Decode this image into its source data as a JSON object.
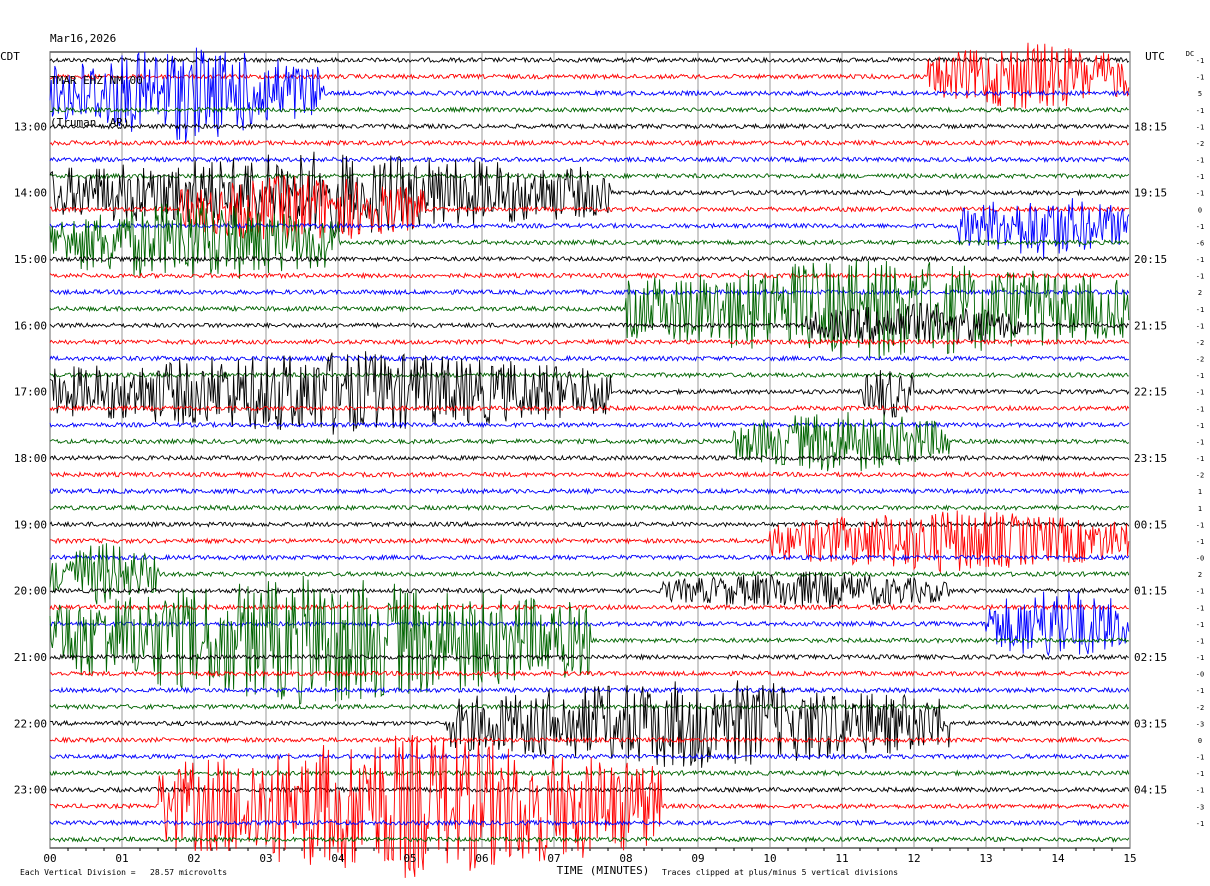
{
  "header": {
    "date": "Mar16,2026",
    "station": "TMAR EHZ NM 00",
    "location": "(Truman, AR)"
  },
  "footer": {
    "scale_note": "Each Vertical Division =   28.57 microvolts",
    "xlabel": "TIME (MINUTES)",
    "clip_note": "Traces clipped at plus/minus 5 vertical divisions"
  },
  "colors": {
    "trace_cycle": [
      "#000000",
      "#ff0000",
      "#0000ff",
      "#006400"
    ],
    "grid": "#808080",
    "background": "#ffffff"
  },
  "chart_data": {
    "type": "line",
    "title": "TMAR EHZ NM 00",
    "xlabel": "TIME (MINUTES)",
    "xlim": [
      0,
      15
    ],
    "x_ticks": [
      "00",
      "01",
      "02",
      "03",
      "04",
      "05",
      "06",
      "07",
      "08",
      "09",
      "10",
      "11",
      "12",
      "13",
      "14",
      "15"
    ],
    "left_axis_label": "CDT",
    "right_axis_label": "UTC",
    "right_column_label": "DC",
    "trace_count": 48,
    "minutes_per_trace": 15,
    "left_hour_labels": [
      {
        "trace": 4,
        "label": "13:00"
      },
      {
        "trace": 8,
        "label": "14:00"
      },
      {
        "trace": 12,
        "label": "15:00"
      },
      {
        "trace": 16,
        "label": "16:00"
      },
      {
        "trace": 20,
        "label": "17:00"
      },
      {
        "trace": 24,
        "label": "18:00"
      },
      {
        "trace": 28,
        "label": "19:00"
      },
      {
        "trace": 32,
        "label": "20:00"
      },
      {
        "trace": 36,
        "label": "21:00"
      },
      {
        "trace": 40,
        "label": "22:00"
      },
      {
        "trace": 44,
        "label": "23:00"
      }
    ],
    "right_hour_labels": [
      {
        "trace": 4,
        "label": "18:15"
      },
      {
        "trace": 8,
        "label": "19:15"
      },
      {
        "trace": 12,
        "label": "20:15"
      },
      {
        "trace": 16,
        "label": "21:15"
      },
      {
        "trace": 20,
        "label": "22:15"
      },
      {
        "trace": 24,
        "label": "23:15"
      },
      {
        "trace": 28,
        "label": "00:15"
      },
      {
        "trace": 32,
        "label": "01:15"
      },
      {
        "trace": 36,
        "label": "02:15"
      },
      {
        "trace": 40,
        "label": "03:15"
      },
      {
        "trace": 44,
        "label": "04:15"
      }
    ],
    "dc_offsets": [
      "-1",
      "-1",
      "5",
      "-1",
      "-1",
      "-2",
      "-1",
      "-1",
      "-1",
      "0",
      "-1",
      "-6",
      "-1",
      "-1",
      "2",
      "-1",
      "-1",
      "-2",
      "-2",
      "-1",
      "-1",
      "-1",
      "-1",
      "-1",
      "-1",
      "-2",
      "1",
      "1",
      "-1",
      "-1",
      "-0",
      "2",
      "-1",
      "-1",
      "-1",
      "-1",
      "-1",
      "-0",
      "-1",
      "-2",
      "-3",
      "0",
      "-1",
      "-1",
      "-1",
      "-3",
      "-1"
    ],
    "series_cycle": [
      "black",
      "red",
      "blue",
      "green"
    ],
    "events": [
      {
        "trace": 1,
        "x_start": 12.2,
        "x_end": 15.0,
        "amplitude": 2.2
      },
      {
        "trace": 2,
        "x_start": 0.0,
        "x_end": 3.8,
        "amplitude": 3.0
      },
      {
        "trace": 8,
        "x_start": 0.0,
        "x_end": 7.8,
        "amplitude": 2.6
      },
      {
        "trace": 9,
        "x_start": 1.8,
        "x_end": 5.2,
        "amplitude": 2.2
      },
      {
        "trace": 10,
        "x_start": 12.6,
        "x_end": 15.0,
        "amplitude": 2.0
      },
      {
        "trace": 11,
        "x_start": 0.0,
        "x_end": 4.0,
        "amplitude": 2.6
      },
      {
        "trace": 15,
        "x_start": 8.0,
        "x_end": 15.0,
        "amplitude": 3.2
      },
      {
        "trace": 16,
        "x_start": 10.5,
        "x_end": 13.5,
        "amplitude": 1.4
      },
      {
        "trace": 20,
        "x_start": 0.0,
        "x_end": 7.8,
        "amplitude": 2.6
      },
      {
        "trace": 20,
        "x_start": 11.3,
        "x_end": 12.0,
        "amplitude": 1.8
      },
      {
        "trace": 23,
        "x_start": 9.5,
        "x_end": 12.5,
        "amplitude": 2.0
      },
      {
        "trace": 29,
        "x_start": 10.0,
        "x_end": 15.0,
        "amplitude": 2.0
      },
      {
        "trace": 31,
        "x_start": 0.0,
        "x_end": 1.5,
        "amplitude": 2.0
      },
      {
        "trace": 32,
        "x_start": 8.5,
        "x_end": 12.5,
        "amplitude": 1.2
      },
      {
        "trace": 34,
        "x_start": 13.0,
        "x_end": 15.0,
        "amplitude": 2.4
      },
      {
        "trace": 35,
        "x_start": 0.0,
        "x_end": 7.5,
        "amplitude": 4.0
      },
      {
        "trace": 40,
        "x_start": 5.5,
        "x_end": 12.5,
        "amplitude": 2.8
      },
      {
        "trace": 45,
        "x_start": 1.5,
        "x_end": 8.5,
        "amplitude": 4.5
      }
    ]
  }
}
